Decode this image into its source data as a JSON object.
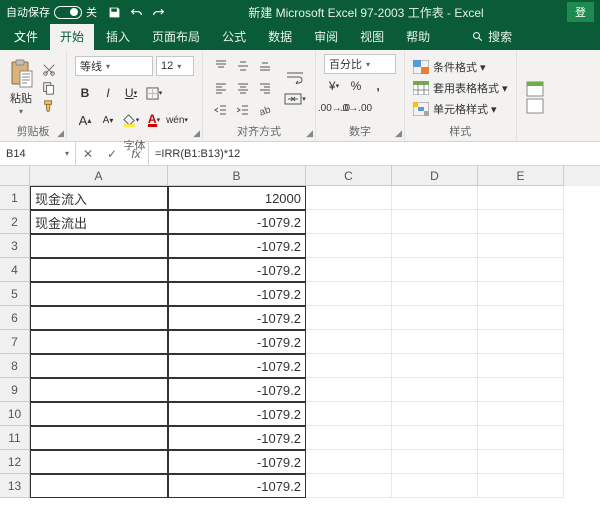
{
  "titlebar": {
    "autosave_label": "自动保存",
    "toggle_state": "关",
    "doc_title": "新建 Microsoft Excel 97-2003 工作表  -  Excel",
    "login": "登"
  },
  "tabs": {
    "file": "文件",
    "home": "开始",
    "insert": "插入",
    "layout": "页面布局",
    "formula": "公式",
    "data": "数据",
    "review": "审阅",
    "view": "视图",
    "help": "帮助",
    "search": "搜索"
  },
  "ribbon": {
    "clipboard": {
      "paste": "粘贴",
      "group": "剪贴板"
    },
    "font": {
      "name": "等线",
      "size": "12",
      "increase": "A",
      "decrease": "A",
      "group": "字体"
    },
    "align": {
      "group": "对齐方式"
    },
    "number": {
      "format": "百分比",
      "group": "数字"
    },
    "styles": {
      "cond": "条件格式 ▾",
      "table": "套用表格格式 ▾",
      "cell": "单元格样式 ▾",
      "group": "样式"
    }
  },
  "formula_bar": {
    "name_box": "B14",
    "formula": "=IRR(B1:B13)*12"
  },
  "columns": [
    "A",
    "B",
    "C",
    "D",
    "E"
  ],
  "rows": [
    {
      "n": 1,
      "A": "现金流入",
      "B": "12000"
    },
    {
      "n": 2,
      "A": "现金流出",
      "B": "-1079.2"
    },
    {
      "n": 3,
      "A": "",
      "B": "-1079.2"
    },
    {
      "n": 4,
      "A": "",
      "B": "-1079.2"
    },
    {
      "n": 5,
      "A": "",
      "B": "-1079.2"
    },
    {
      "n": 6,
      "A": "",
      "B": "-1079.2"
    },
    {
      "n": 7,
      "A": "",
      "B": "-1079.2"
    },
    {
      "n": 8,
      "A": "",
      "B": "-1079.2"
    },
    {
      "n": 9,
      "A": "",
      "B": "-1079.2"
    },
    {
      "n": 10,
      "A": "",
      "B": "-1079.2"
    },
    {
      "n": 11,
      "A": "",
      "B": "-1079.2"
    },
    {
      "n": 12,
      "A": "",
      "B": "-1079.2"
    },
    {
      "n": 13,
      "A": "",
      "B": "-1079.2"
    }
  ]
}
